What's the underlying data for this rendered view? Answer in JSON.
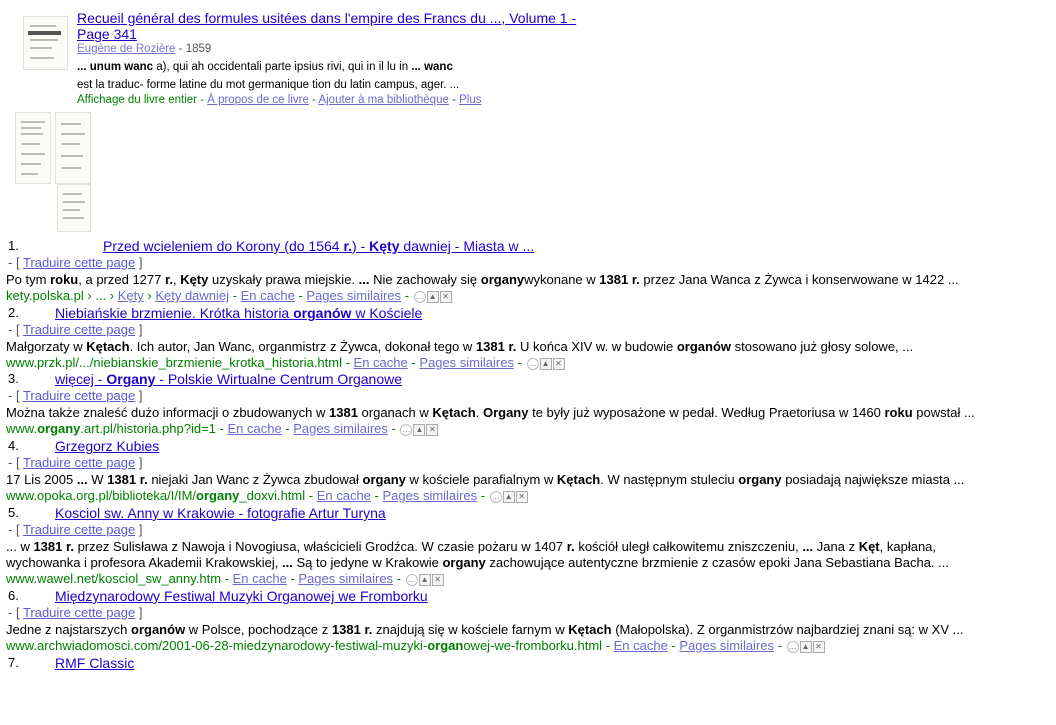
{
  "book": {
    "title_line1": "Recueil général des formules usitées dans l'empire des Francs du ..., Volume 1 -",
    "title_line2": "Page 341",
    "author": "Eugène de Rozière",
    "year": " - 1859",
    "snippet_line1_a": "... unum ",
    "snippet_line1_b": "wanc",
    "snippet_line1_c": " a), qui ah occidentali parte ipsius rivi, qui in il lu in ",
    "snippet_line1_d": "... wanc",
    "snippet_line2": "est la traduc- forme latine du mot germanique tion du latin campus, ager. ...",
    "action_full": "Affichage du livre entier",
    "action_sep": " - ",
    "action_about": "À propos de ce livre",
    "action_add": "Ajouter à ma bibliothèque",
    "action_more": "Plus"
  },
  "translate": {
    "prefix": "- [ ",
    "label": "Traduire cette page",
    "suffix": " ]"
  },
  "common": {
    "cache": "En cache",
    "similar": "Pages similaires",
    "sep": " - "
  },
  "results": [
    {
      "num": "1.",
      "title": [
        [
          "Przed wcieleniem do Korony (do 1564 ",
          false
        ],
        [
          "r.",
          true
        ],
        [
          ") - ",
          false
        ],
        [
          "Kęty",
          true
        ],
        [
          " dawniej - Miasta w ...",
          false
        ]
      ],
      "snippet": [
        [
          "Po tym ",
          false
        ],
        [
          "roku",
          true
        ],
        [
          ", a przed 1277 ",
          false
        ],
        [
          "r.",
          true
        ],
        [
          ", ",
          false
        ],
        [
          "Kęty",
          true
        ],
        [
          " uzyskały prawa miejskie. ",
          false
        ],
        [
          "...",
          true
        ],
        [
          " Nie zachowały się ",
          false
        ],
        [
          "organy",
          true
        ],
        [
          "wykonane w ",
          false
        ],
        [
          "1381",
          true
        ],
        [
          " ",
          false
        ],
        [
          "r.",
          true
        ],
        [
          " przez Jana Wanca z Żywca i konserwowane w 1422 ...",
          false
        ]
      ],
      "url": [
        [
          "kety.polska.pl › ... › ",
          false
        ],
        [
          "Kęty",
          false
        ],
        [
          " › ",
          false
        ],
        [
          "Kęty dawniej",
          false
        ]
      ]
    },
    {
      "num": "2.",
      "title": [
        [
          "Niebiańskie brzmienie. Krótka historia ",
          false
        ],
        [
          "organów",
          true
        ],
        [
          " w Kościele",
          false
        ]
      ],
      "snippet": [
        [
          "Małgorzaty w ",
          false
        ],
        [
          "Kętach",
          true
        ],
        [
          ". Ich autor, Jan Wanc, organmistrz z Żywca, dokonał tego w ",
          false
        ],
        [
          "1381",
          true
        ],
        [
          " ",
          false
        ],
        [
          "r.",
          true
        ],
        [
          " U końca XIV w. w budowie ",
          false
        ],
        [
          "organów",
          true
        ],
        [
          " stosowano już głosy solowe, ...",
          false
        ]
      ],
      "url": [
        [
          "www.przk.pl/.../niebianskie_brzmienie_krotka_historia.html",
          false
        ]
      ]
    },
    {
      "num": "3.",
      "title": [
        [
          "więcej - ",
          false
        ],
        [
          "Organy",
          true
        ],
        [
          " - Polskie Wirtualne Centrum Organowe",
          false
        ]
      ],
      "snippet": [
        [
          "Można także znaleść dużo informacji o zbudowanych w ",
          false
        ],
        [
          "1381",
          true
        ],
        [
          " organach w ",
          false
        ],
        [
          "Kętach",
          true
        ],
        [
          ". ",
          false
        ],
        [
          "Organy",
          true
        ],
        [
          " te były już wyposażone w pedał. Według Praetoriusa w 1460 ",
          false
        ],
        [
          "roku",
          true
        ],
        [
          " powstał ...",
          false
        ]
      ],
      "url": [
        [
          "www.",
          false
        ],
        [
          "organy",
          true
        ],
        [
          ".art.pl/historia.php?id=1",
          false
        ]
      ]
    },
    {
      "num": "4.",
      "title": [
        [
          "Grzegorz Kubies",
          false
        ]
      ],
      "snippet": [
        [
          "17 Lis 2005 ",
          false
        ],
        [
          "...",
          true
        ],
        [
          " W ",
          false
        ],
        [
          "1381",
          true
        ],
        [
          " ",
          false
        ],
        [
          "r.",
          true
        ],
        [
          " niejaki Jan Wanc z Żywca zbudował ",
          false
        ],
        [
          "organy",
          true
        ],
        [
          " w kościele parafialnym w ",
          false
        ],
        [
          "Kętach",
          true
        ],
        [
          ". W następnym stuleciu ",
          false
        ],
        [
          "organy",
          true
        ],
        [
          " posiadają największe miasta ...",
          false
        ]
      ],
      "url": [
        [
          "www.opoka.org.pl/biblioteka/I/IM/",
          false
        ],
        [
          "organy",
          true
        ],
        [
          "_doxvi.html",
          false
        ]
      ]
    },
    {
      "num": "5.",
      "title": [
        [
          "Kosciol sw. Anny w Krakowie - fotografie Artur Turyna",
          false
        ]
      ],
      "snippet": [
        [
          "... w ",
          false
        ],
        [
          "1381",
          true
        ],
        [
          " ",
          false
        ],
        [
          "r.",
          true
        ],
        [
          " przez Sulisława z Nawoja i Novogiusa, właścicieli Grodźca. W czasie pożaru w 1407 ",
          false
        ],
        [
          "r.",
          true
        ],
        [
          " kościół uległ całkowitemu zniszczeniu, ",
          false
        ],
        [
          "...",
          true
        ],
        [
          " Jana z ",
          false
        ],
        [
          "Kęt",
          true
        ],
        [
          ", kapłana,",
          false
        ]
      ],
      "snippet2": [
        [
          "wychowanka i profesora Akademii Krakowskiej, ",
          false
        ],
        [
          "...",
          true
        ],
        [
          " Są to jedyne w Krakowie ",
          false
        ],
        [
          "organy",
          true
        ],
        [
          " zachowujące autentyczne brzmienie z czasów epoki Jana Sebastiana Bacha. ...",
          false
        ]
      ],
      "url": [
        [
          "www.wawel.net/kosciol_sw_anny.htm",
          false
        ]
      ]
    },
    {
      "num": "6.",
      "title": [
        [
          "Międzynarodowy Festiwal Muzyki Organowej we Fromborku",
          false
        ]
      ],
      "snippet": [
        [
          "Jedne z najstarszych ",
          false
        ],
        [
          "organów",
          true
        ],
        [
          " w Polsce, pochodzące z ",
          false
        ],
        [
          "1381",
          true
        ],
        [
          " ",
          false
        ],
        [
          "r.",
          true
        ],
        [
          " znajdują się w kościele farnym w ",
          false
        ],
        [
          "Kętach",
          true
        ],
        [
          " (Małopolska). Z organmistrzów najbardziej znani są: w XV ...",
          false
        ]
      ],
      "url": [
        [
          "www.archwiadomosci.com/2001-06-28-miedzynarodowy-festiwal-muzyki-",
          false
        ],
        [
          "organ",
          true
        ],
        [
          "owej-we-fromborku.html",
          false
        ]
      ]
    },
    {
      "num": "7.",
      "title": [
        [
          "RMF Classic",
          false
        ]
      ]
    }
  ]
}
